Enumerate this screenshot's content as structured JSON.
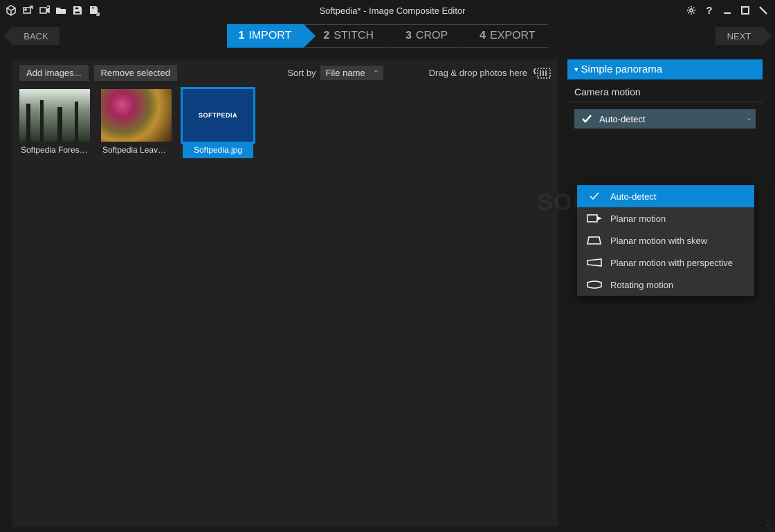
{
  "title": "Softpedia* - Image Composite Editor",
  "nav": {
    "back": "BACK",
    "next": "NEXT"
  },
  "steps": [
    {
      "num": "1",
      "label": "IMPORT",
      "active": true
    },
    {
      "num": "2",
      "label": "STITCH",
      "active": false
    },
    {
      "num": "3",
      "label": "CROP",
      "active": false
    },
    {
      "num": "4",
      "label": "EXPORT",
      "active": false
    }
  ],
  "toolbar": {
    "add_images": "Add images...",
    "remove_selected": "Remove selected",
    "sort_by_label": "Sort by",
    "sort_value": "File name",
    "drag_hint": "Drag & drop photos here"
  },
  "thumbs": [
    {
      "label": "Softpedia Forest.j...",
      "selected": false,
      "kind": "forest"
    },
    {
      "label": "Softpedia Leaves....",
      "selected": false,
      "kind": "leaves"
    },
    {
      "label": "Softpedia.jpg",
      "selected": true,
      "kind": "logo"
    }
  ],
  "right": {
    "panel_title": "Simple panorama",
    "section_title": "Camera motion",
    "selected_motion": "Auto-detect"
  },
  "dropdown": {
    "items": [
      {
        "label": "Auto-detect",
        "icon": "check",
        "highlighted": true
      },
      {
        "label": "Planar motion",
        "icon": "planar",
        "highlighted": false
      },
      {
        "label": "Planar motion with skew",
        "icon": "skew",
        "highlighted": false
      },
      {
        "label": "Planar motion with perspective",
        "icon": "persp",
        "highlighted": false
      },
      {
        "label": "Rotating motion",
        "icon": "rotate",
        "highlighted": false
      }
    ]
  },
  "watermark": "SOFTPEDIA",
  "logo_text": "SOFTPEDIA"
}
